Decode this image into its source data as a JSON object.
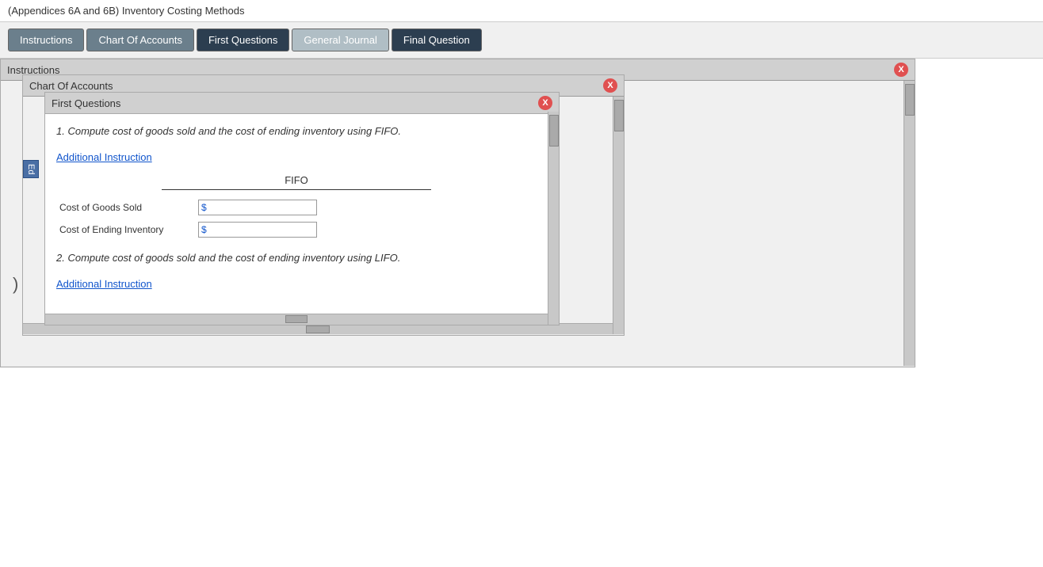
{
  "page": {
    "title": "(Appendices 6A and 6B) Inventory Costing Methods"
  },
  "tabs": [
    {
      "id": "instructions",
      "label": "Instructions",
      "style": "normal"
    },
    {
      "id": "chart-of-accounts",
      "label": "Chart Of Accounts",
      "style": "normal"
    },
    {
      "id": "first-questions",
      "label": "First Questions",
      "style": "active"
    },
    {
      "id": "general-journal",
      "label": "General Journal",
      "style": "light"
    },
    {
      "id": "final-question",
      "label": "Final Question",
      "style": "active"
    }
  ],
  "panels": {
    "instructions": {
      "title": "Instructions",
      "close_label": "X"
    },
    "chart_of_accounts": {
      "title": "Chart Of Accounts",
      "close_label": "X"
    },
    "first_questions": {
      "title": "First Questions",
      "close_label": "X",
      "question1_text": "1. Compute cost of goods sold and the cost of ending inventory using FIFO.",
      "additional_instruction_label": "Additional Instruction",
      "fifo_label": "FIFO",
      "cost_of_goods_sold_label": "Cost of Goods Sold",
      "cost_of_ending_inventory_label": "Cost of Ending Inventory",
      "dollar_sign": "$",
      "question2_text": "2. Compute cost of goods sold and the cost of ending inventory using LIFO.",
      "additional_instruction_label2": "Additional Instruction"
    }
  },
  "left_button_label": "Ed",
  "left_paren": ")"
}
